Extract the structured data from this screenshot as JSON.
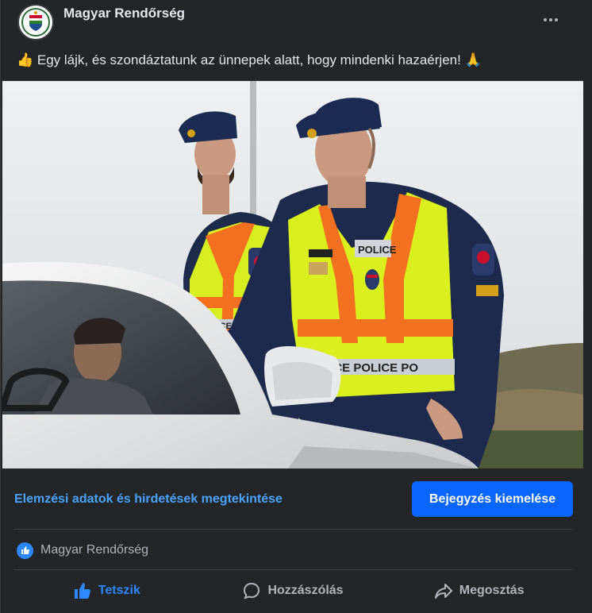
{
  "post": {
    "page_name": "Magyar Rendőrség",
    "text": "👍 Egy lájk, és szondáztatunk az ünnepek alatt, hogy mindenki hazaérjen! 🙏",
    "photo": {
      "vest_text_main": "POLICE",
      "vest_text_band": "LICE POLICE PO",
      "vest_text_small": "POLICE"
    }
  },
  "actions": {
    "insights_label": "Elemzési adatok és hirdetések megtekintése",
    "boost_label": "Bejegyzés kiemelése"
  },
  "reactions": {
    "summary": "Magyar Rendőrség"
  },
  "buttons": {
    "like": "Tetszik",
    "comment": "Hozzászólás",
    "share": "Megosztás"
  },
  "colors": {
    "background": "#242526",
    "primary_button": "#0866ff",
    "link": "#4aa3ff",
    "liked": "#2d88ff"
  }
}
